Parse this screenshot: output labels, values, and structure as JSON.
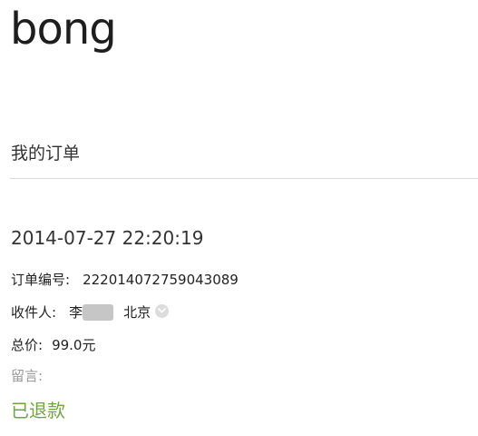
{
  "header": {
    "logo_text": "bong"
  },
  "page": {
    "title": "我的订单"
  },
  "order": {
    "datetime": "2014-07-27 22:20:19",
    "number_label": "订单编号:",
    "number_value": "222014072759043089",
    "recipient_label": "收件人:",
    "recipient_name": "李",
    "recipient_city": "北京",
    "total_label": "总价:",
    "total_value": "99.0元",
    "message_label": "留言:",
    "status": "已退款"
  },
  "colors": {
    "status_green": "#6fa53d",
    "muted_gray": "#9a9a9a",
    "divider": "#d9d9d9"
  },
  "icons": {
    "recipient_toggle": "chevron-down-icon"
  }
}
